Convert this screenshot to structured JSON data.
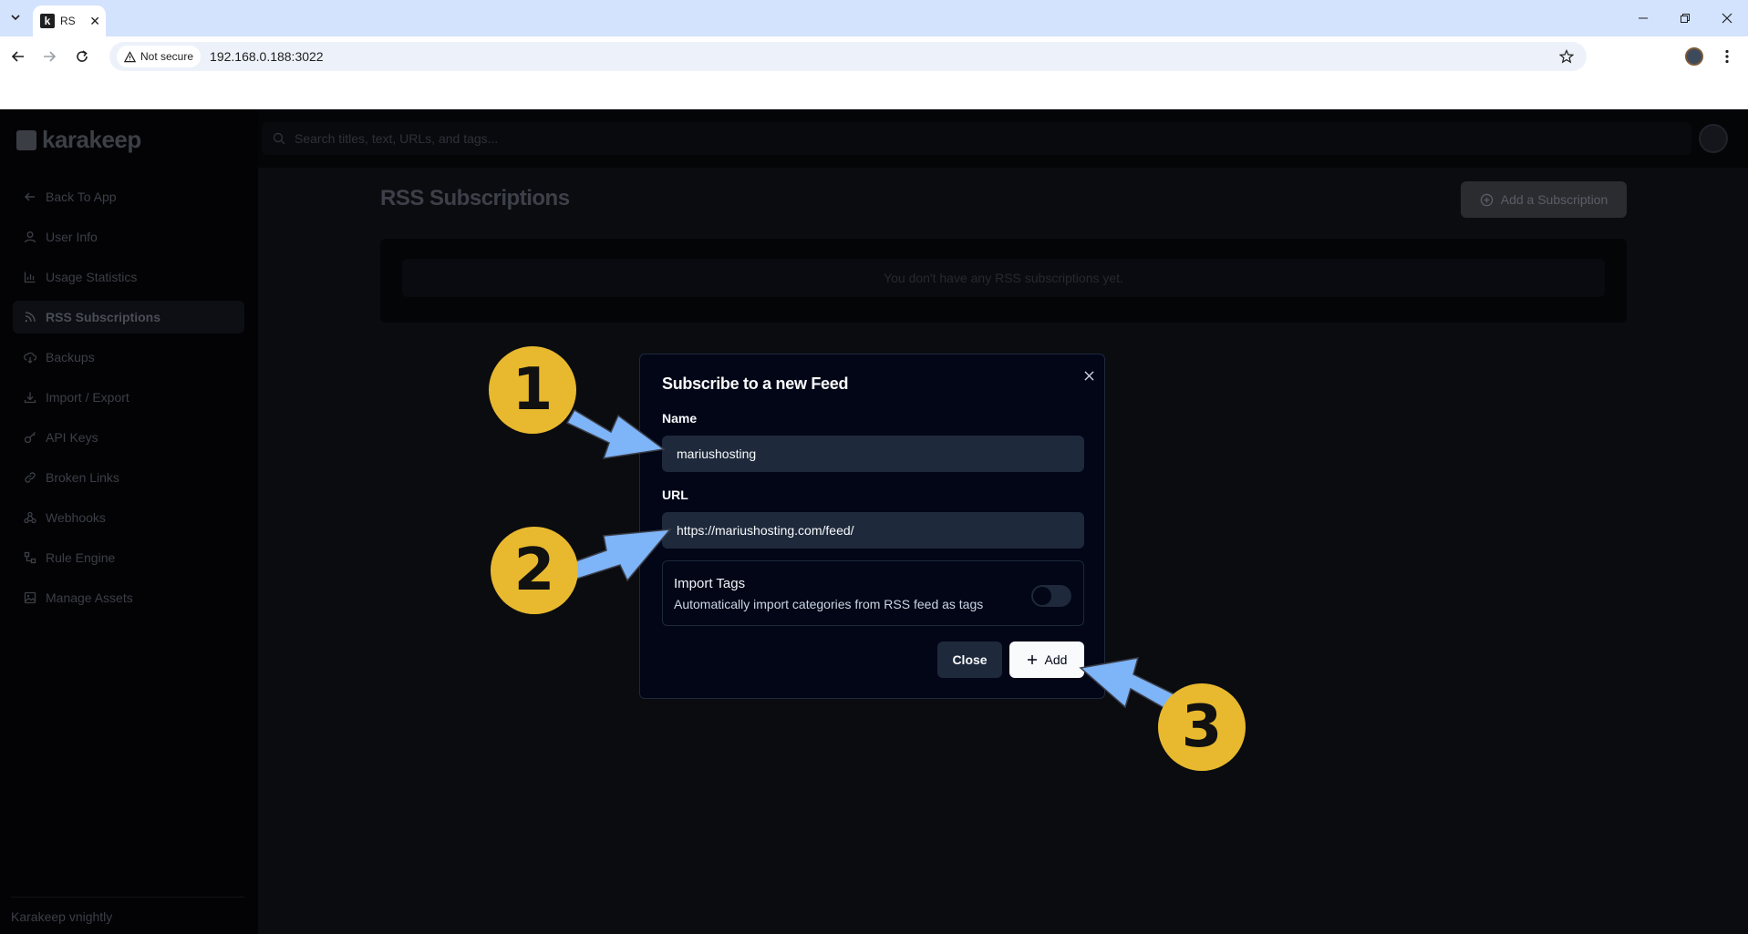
{
  "browser": {
    "tab_title": "RS",
    "security_label": "Not secure",
    "url": "192.168.0.188:3022"
  },
  "app": {
    "brand": "karakeep",
    "search_placeholder": "Search titles, text, URLs, and tags...",
    "version": "Karakeep vnightly",
    "nav": [
      {
        "label": "Back To App",
        "icon": "arrow-left-icon"
      },
      {
        "label": "User Info",
        "icon": "user-icon"
      },
      {
        "label": "Usage Statistics",
        "icon": "bar-chart-icon"
      },
      {
        "label": "RSS Subscriptions",
        "icon": "rss-icon",
        "active": true
      },
      {
        "label": "Backups",
        "icon": "cloud-download-icon"
      },
      {
        "label": "Import / Export",
        "icon": "download-icon"
      },
      {
        "label": "API Keys",
        "icon": "key-icon"
      },
      {
        "label": "Broken Links",
        "icon": "link-icon"
      },
      {
        "label": "Webhooks",
        "icon": "webhook-icon"
      },
      {
        "label": "Rule Engine",
        "icon": "workflow-icon"
      },
      {
        "label": "Manage Assets",
        "icon": "image-icon"
      }
    ],
    "page_title": "RSS Subscriptions",
    "add_subscription_label": "Add a Subscription",
    "empty_message": "You don't have any RSS subscriptions yet."
  },
  "dialog": {
    "title": "Subscribe to a new Feed",
    "name_label": "Name",
    "name_value": "mariushosting",
    "url_label": "URL",
    "url_value": "https://mariushosting.com/feed/",
    "import_tags_title": "Import Tags",
    "import_tags_desc": "Automatically import categories from RSS feed as tags",
    "import_tags_enabled": false,
    "close_label": "Close",
    "add_label": "Add"
  },
  "annotations": {
    "badges": [
      "1",
      "2",
      "3"
    ],
    "badge_color": "#e8b92e",
    "arrow_color": "#7eb4f8"
  }
}
